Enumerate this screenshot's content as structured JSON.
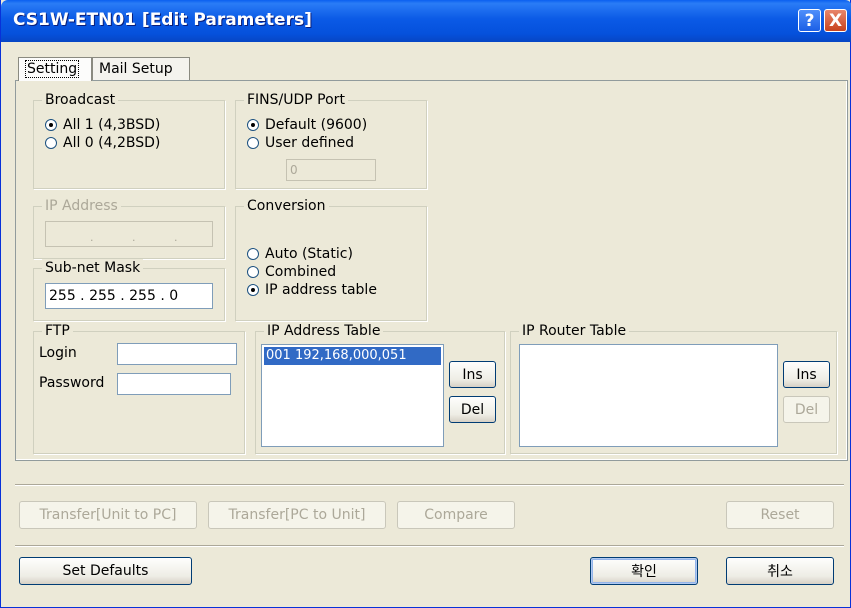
{
  "window": {
    "title": "CS1W-ETN01 [Edit Parameters]",
    "help_glyph": "?",
    "close_glyph": "X"
  },
  "tabs": [
    {
      "label": "Setting"
    },
    {
      "label": "Mail Setup"
    }
  ],
  "broadcast": {
    "title": "Broadcast",
    "options": [
      "All 1 (4,3BSD)",
      "All 0 (4,2BSD)"
    ],
    "selected": 0
  },
  "fins_udp": {
    "title": "FINS/UDP Port",
    "options": [
      "Default (9600)",
      "User defined"
    ],
    "selected": 0,
    "port_value": "0"
  },
  "ip_address": {
    "title": "IP Address",
    "value": " .  .  . "
  },
  "subnet": {
    "title": "Sub-net Mask",
    "value": "255 . 255 . 255 .   0"
  },
  "conversion": {
    "title": "Conversion",
    "options": [
      "Auto (Static)",
      "Combined",
      "IP address table"
    ],
    "selected": 2
  },
  "ftp": {
    "title": "FTP",
    "login_label": "Login",
    "password_label": "Password",
    "login_value": "",
    "password_value": ""
  },
  "ip_address_table": {
    "title": "IP Address Table",
    "rows": [
      "001  192,168,000,051"
    ],
    "ins_label": "Ins",
    "del_label": "Del"
  },
  "ip_router_table": {
    "title": "IP Router Table",
    "rows": [],
    "ins_label": "Ins",
    "del_label": "Del"
  },
  "transfer_bar": {
    "unit_to_pc": "Transfer[Unit to PC]",
    "pc_to_unit": "Transfer[PC to Unit]",
    "compare": "Compare",
    "reset": "Reset"
  },
  "footer": {
    "set_defaults": "Set Defaults",
    "ok": "확인",
    "cancel": "취소"
  }
}
